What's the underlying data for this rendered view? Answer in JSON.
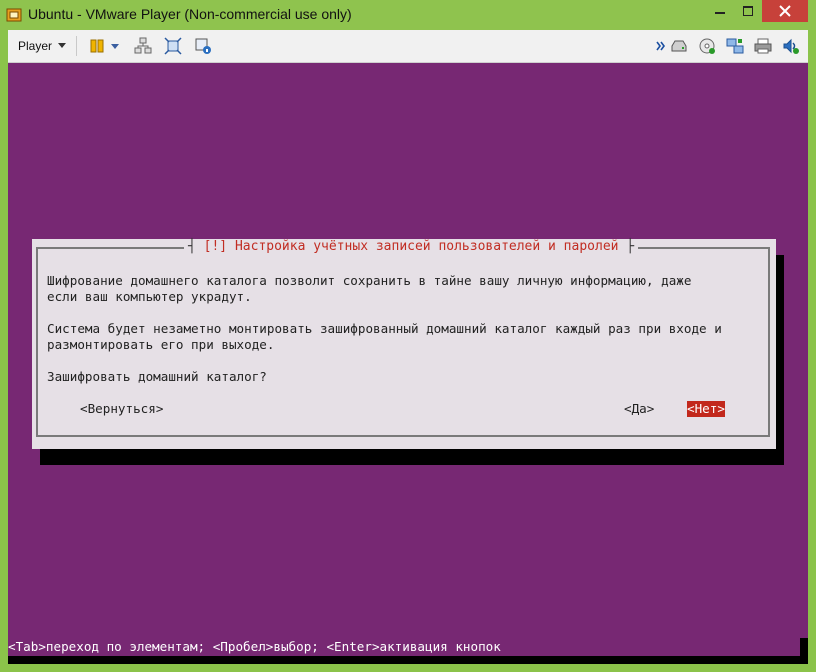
{
  "window": {
    "title": "Ubuntu - VMware Player (Non-commercial use only)",
    "frame_color": "#8bc34a",
    "close_color": "#c7413a"
  },
  "toolbar": {
    "player_label": "Player",
    "icons": [
      "pause-icon",
      "send-ctrl-alt-del-icon",
      "fullscreen-icon",
      "unity-icon",
      "hard-disk-icon",
      "cd-icon",
      "network-icon",
      "printer-icon",
      "sound-icon"
    ]
  },
  "vm": {
    "background": "#772873",
    "dialog": {
      "title": "[!] Настройка учётных записей пользователей и паролей",
      "paragraph1": "Шифрование домашнего каталога позволит сохранить в тайне вашу личную информацию, даже\nесли ваш компьютер украдут.",
      "paragraph2": "Система будет незаметно монтировать зашифрованный домашний каталог каждый раз при входе и\nразмонтировать его при выходе.",
      "question": "Зашифровать домашний каталог?",
      "back_button": "<Вернуться>",
      "yes_button": "<Да>",
      "no_button": "<Нет>",
      "selected_color": "#c2281c"
    },
    "status_line": "<Tab>переход по элементам; <Пробел>выбор; <Enter>активация кнопок"
  }
}
